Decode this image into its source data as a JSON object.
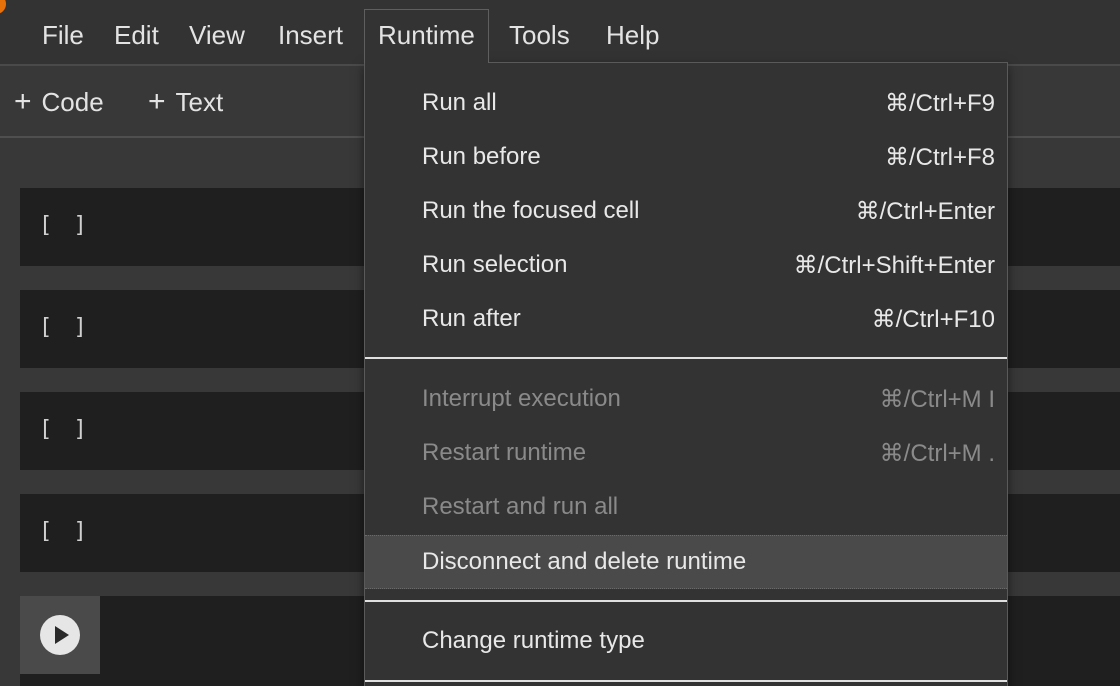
{
  "menubar": {
    "items": [
      {
        "label": "File"
      },
      {
        "label": "Edit"
      },
      {
        "label": "View"
      },
      {
        "label": "Insert"
      },
      {
        "label": "Runtime"
      },
      {
        "label": "Tools"
      },
      {
        "label": "Help"
      }
    ],
    "active": "Runtime"
  },
  "toolbar": {
    "add_code_label": "Code",
    "add_text_label": "Text",
    "plus_glyph": "+"
  },
  "cells": [
    {
      "bracket": "[ ]"
    },
    {
      "bracket": "[ ]"
    },
    {
      "bracket": "[ ]"
    },
    {
      "bracket": "[ ]"
    }
  ],
  "runtime_menu": {
    "groups": [
      [
        {
          "label": "Run all",
          "shortcut": "⌘/Ctrl+F9",
          "enabled": true
        },
        {
          "label": "Run before",
          "shortcut": "⌘/Ctrl+F8",
          "enabled": true
        },
        {
          "label": "Run the focused cell",
          "shortcut": "⌘/Ctrl+Enter",
          "enabled": true
        },
        {
          "label": "Run selection",
          "shortcut": "⌘/Ctrl+Shift+Enter",
          "enabled": true
        },
        {
          "label": "Run after",
          "shortcut": "⌘/Ctrl+F10",
          "enabled": true
        }
      ],
      [
        {
          "label": "Interrupt execution",
          "shortcut": "⌘/Ctrl+M I",
          "enabled": false
        },
        {
          "label": "Restart runtime",
          "shortcut": "⌘/Ctrl+M .",
          "enabled": false
        },
        {
          "label": "Restart and run all",
          "shortcut": "",
          "enabled": false
        },
        {
          "label": "Disconnect and delete runtime",
          "shortcut": "",
          "enabled": true,
          "highlighted": true
        }
      ],
      [
        {
          "label": "Change runtime type",
          "shortcut": "",
          "enabled": true
        }
      ]
    ]
  },
  "colors": {
    "background": "#383838",
    "menubar": "#333333",
    "cell": "#1f1f1f",
    "highlight": "#4a4a4a",
    "disabled_text": "#8a8a8a",
    "brand_accent": "#e8710a"
  }
}
